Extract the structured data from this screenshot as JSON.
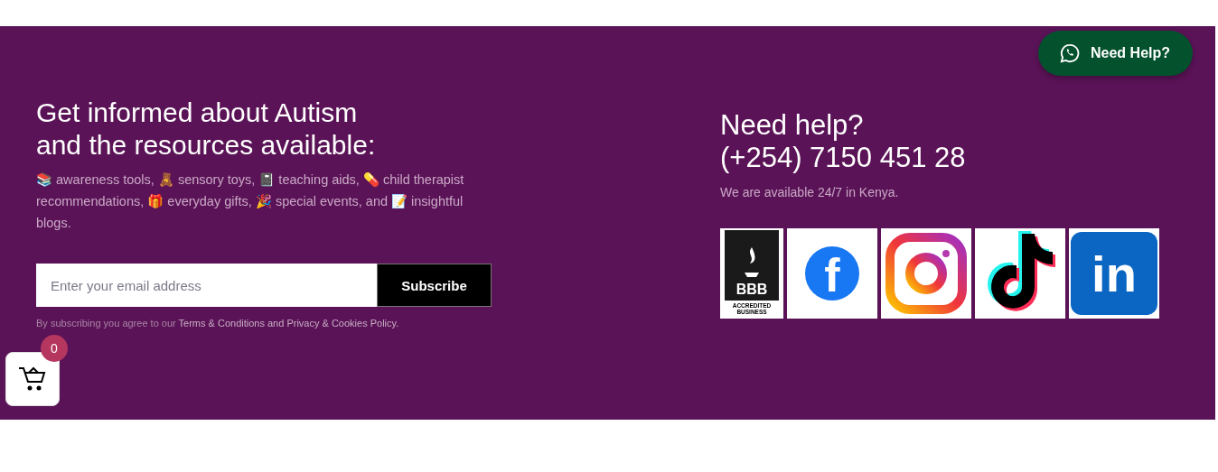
{
  "newsletter": {
    "heading_lines": [
      "Get informed about Autism",
      "and the resources available:"
    ],
    "description": "📚 awareness tools, 🧸 sensory toys, 📓 teaching aids, 💊 child therapist recommendations, 🎁 everyday gifts, 🎉 special events, and 📝 insightful blogs.",
    "email_field": {
      "placeholder": "Enter your email address"
    },
    "subscribe_button": "Subscribe",
    "consent_prefix": "By subscribing you agree to our ",
    "consent_link": "Terms & Conditions and Privacy & Cookies Policy."
  },
  "contact": {
    "heading": "Need help?",
    "phone": "(+254) 7150 451 28",
    "availability": "We are available 24/7 in Kenya."
  },
  "badges": [
    {
      "kind": "bbb",
      "lines": [
        "BBB",
        "ACCREDITED",
        "BUSINESS"
      ]
    },
    {
      "kind": "facebook",
      "lines": [
        "f"
      ]
    },
    {
      "kind": "instagram"
    },
    {
      "kind": "tiktok"
    },
    {
      "kind": "linkedin",
      "lines": [
        "in"
      ]
    }
  ],
  "help_button": "Need Help?",
  "cart": {
    "count": "0"
  }
}
